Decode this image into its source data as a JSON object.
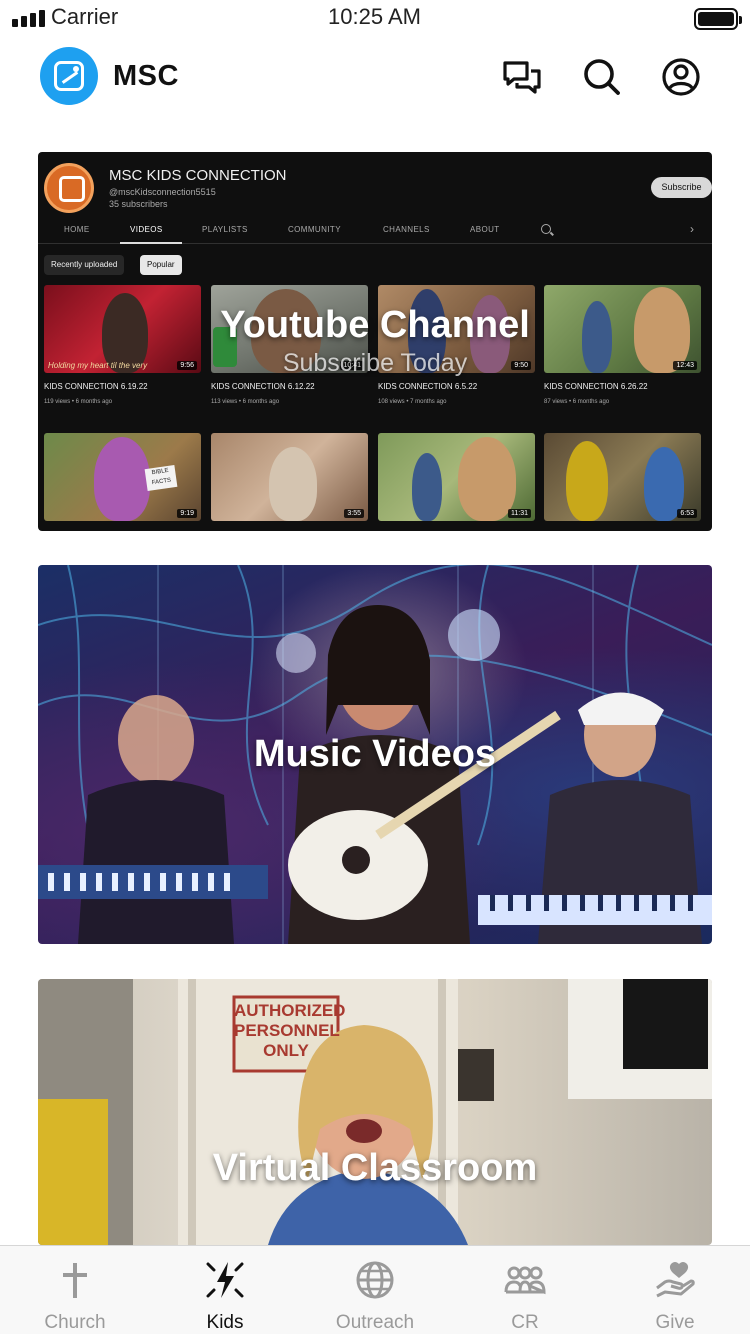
{
  "status_bar": {
    "carrier": "Carrier",
    "time": "10:25 AM"
  },
  "header": {
    "brand": "MSC",
    "icons": [
      "logo-icon",
      "chat-icon",
      "search-icon",
      "account-icon"
    ]
  },
  "youtube_card": {
    "overlay_title": "Youtube Channel",
    "overlay_subtitle": "Subscribe Today",
    "channel": {
      "name": "MSC KIDS CONNECTION",
      "handle": "@mscKidsconnection5515",
      "subscribers": "35 subscribers",
      "subscribe_label": "Subscribe"
    },
    "tabs": [
      "HOME",
      "VIDEOS",
      "PLAYLISTS",
      "COMMUNITY",
      "CHANNELS",
      "ABOUT"
    ],
    "active_tab": "VIDEOS",
    "chips": [
      "Recently uploaded",
      "Popular"
    ],
    "videos_row1": [
      {
        "title": "KIDS CONNECTION 6.19.22",
        "meta": "119 views • 6 months ago",
        "duration": "9:56",
        "caption": "Holding my heart til the very"
      },
      {
        "title": "KIDS CONNECTION 6.12.22",
        "meta": "113 views • 6 months ago",
        "duration": "10:41"
      },
      {
        "title": "KIDS CONNECTION 6.5.22",
        "meta": "108 views • 7 months ago",
        "duration": "9:50"
      },
      {
        "title": "KIDS CONNECTION 6.26.22",
        "meta": "87 views • 6 months ago",
        "duration": "12:43"
      }
    ],
    "videos_row2": [
      {
        "duration": "9:19",
        "caption": "BIBLE FACTS"
      },
      {
        "duration": "3:55"
      },
      {
        "duration": "11:31"
      },
      {
        "duration": "6:53"
      }
    ]
  },
  "music_card": {
    "title": "Music Videos"
  },
  "classroom_card": {
    "title": "Virtual Classroom",
    "sign_text": "AUTHORIZED PERSONNEL ONLY"
  },
  "tab_bar": {
    "items": [
      {
        "label": "Church",
        "icon": "cross-icon"
      },
      {
        "label": "Kids",
        "icon": "kids-star-icon"
      },
      {
        "label": "Outreach",
        "icon": "globe-icon"
      },
      {
        "label": "CR",
        "icon": "group-icon"
      },
      {
        "label": "Give",
        "icon": "hand-heart-icon"
      }
    ],
    "active": "Kids"
  },
  "colors": {
    "accent": "#1ea0f0",
    "youtube_bg": "#0f0f0f",
    "tab_inactive": "#9a9a9a",
    "tab_active": "#111111"
  }
}
